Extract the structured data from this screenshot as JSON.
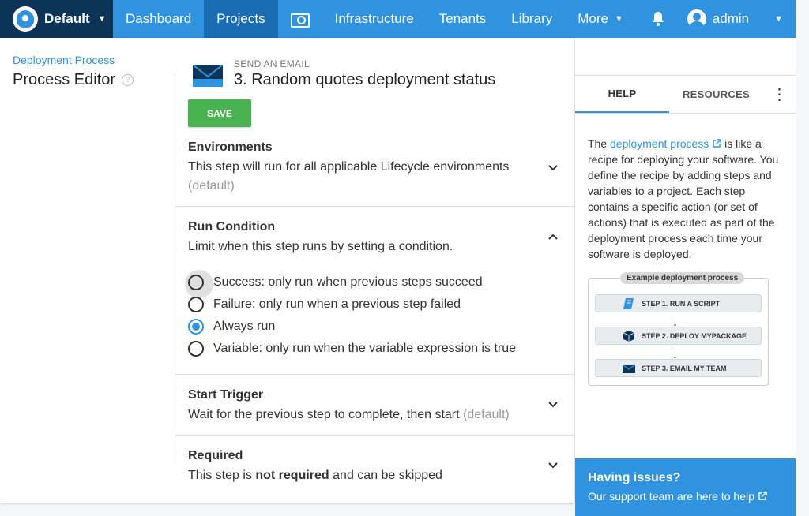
{
  "nav": {
    "space": "Default",
    "items": [
      "Dashboard",
      "Projects",
      "Infrastructure",
      "Tenants",
      "Library",
      "More"
    ],
    "user": "admin"
  },
  "page": {
    "breadcrumb": "Deployment Process",
    "title": "Process Editor"
  },
  "step": {
    "type": "SEND AN EMAIL",
    "title": "3.  Random quotes deployment status",
    "save_label": "SAVE"
  },
  "sections": {
    "environments": {
      "title": "Environments",
      "desc": "This step will run for all applicable Lifecycle environments",
      "default": "(default)"
    },
    "run_condition": {
      "title": "Run Condition",
      "desc": "Limit when this step runs by setting a condition.",
      "options": [
        "Success: only run when previous steps succeed",
        "Failure: only run when a previous step failed",
        "Always run",
        "Variable: only run when the variable expression is true"
      ],
      "selected": "Always run"
    },
    "start_trigger": {
      "title": "Start Trigger",
      "desc": "Wait for the previous step to complete, then start",
      "default": "(default)"
    },
    "required": {
      "title": "Required",
      "desc_pre": "This step is ",
      "desc_bold": "not required",
      "desc_post": " and can be skipped"
    }
  },
  "help": {
    "tabs": [
      "HELP",
      "RESOURCES"
    ],
    "intro_pre": "The ",
    "intro_link": "deployment process",
    "intro_post": " is like a recipe for deploying your software. You define the recipe by adding steps and variables to a project. Each step contains a specific action (or set of actions) that is executed as part of the deployment process each time your software is deployed.",
    "diagram_title": "Example deployment process",
    "diagram_steps": [
      "STEP 1. RUN A SCRIPT",
      "STEP 2. DEPLOY MYPACKAGE",
      "STEP 3. EMAIL MY TEAM"
    ],
    "issues_title": "Having issues?",
    "issues_link": "Our support team are here to help"
  },
  "colors": {
    "accent": "#2f93e0",
    "nav_active": "#1a6cb3",
    "space_bg": "#0d3457",
    "save": "#48b350"
  }
}
